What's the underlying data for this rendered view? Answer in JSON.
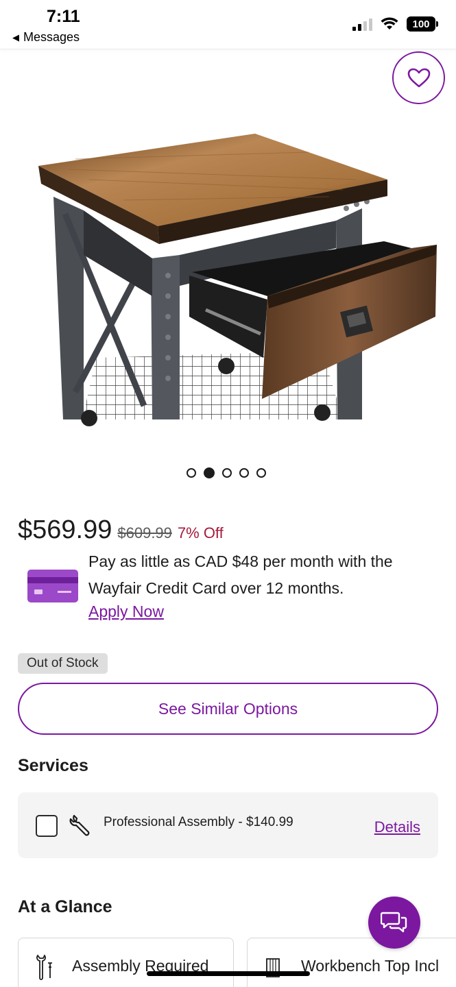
{
  "status_bar": {
    "time": "7:11",
    "back_label": "Messages",
    "battery": "100"
  },
  "product": {
    "image_icon": "workbench-with-drawer-image",
    "carousel": {
      "count": 5,
      "active_index": 1
    },
    "price": "$569.99",
    "original_price": "$609.99",
    "discount": "7% Off",
    "financing_text": "Pay as little as CAD $48 per month with the Wayfair Credit Card over 12 months.",
    "apply_link": "Apply Now",
    "stock_status": "Out of Stock",
    "similar_button": "See Similar Options"
  },
  "services": {
    "title": "Services",
    "item": {
      "label": "Professional Assembly - $140.99",
      "checked": false,
      "details_link": "Details"
    }
  },
  "glance": {
    "title": "At a Glance",
    "cards": [
      {
        "icon": "wrench-screwdriver-icon",
        "label": "Assembly Required"
      },
      {
        "icon": "wood-plank-icon",
        "label": "Workbench Top Incl"
      }
    ]
  },
  "colors": {
    "accent": "#7b189f",
    "discount": "#a51a3c",
    "badge_bg": "#dedede"
  }
}
